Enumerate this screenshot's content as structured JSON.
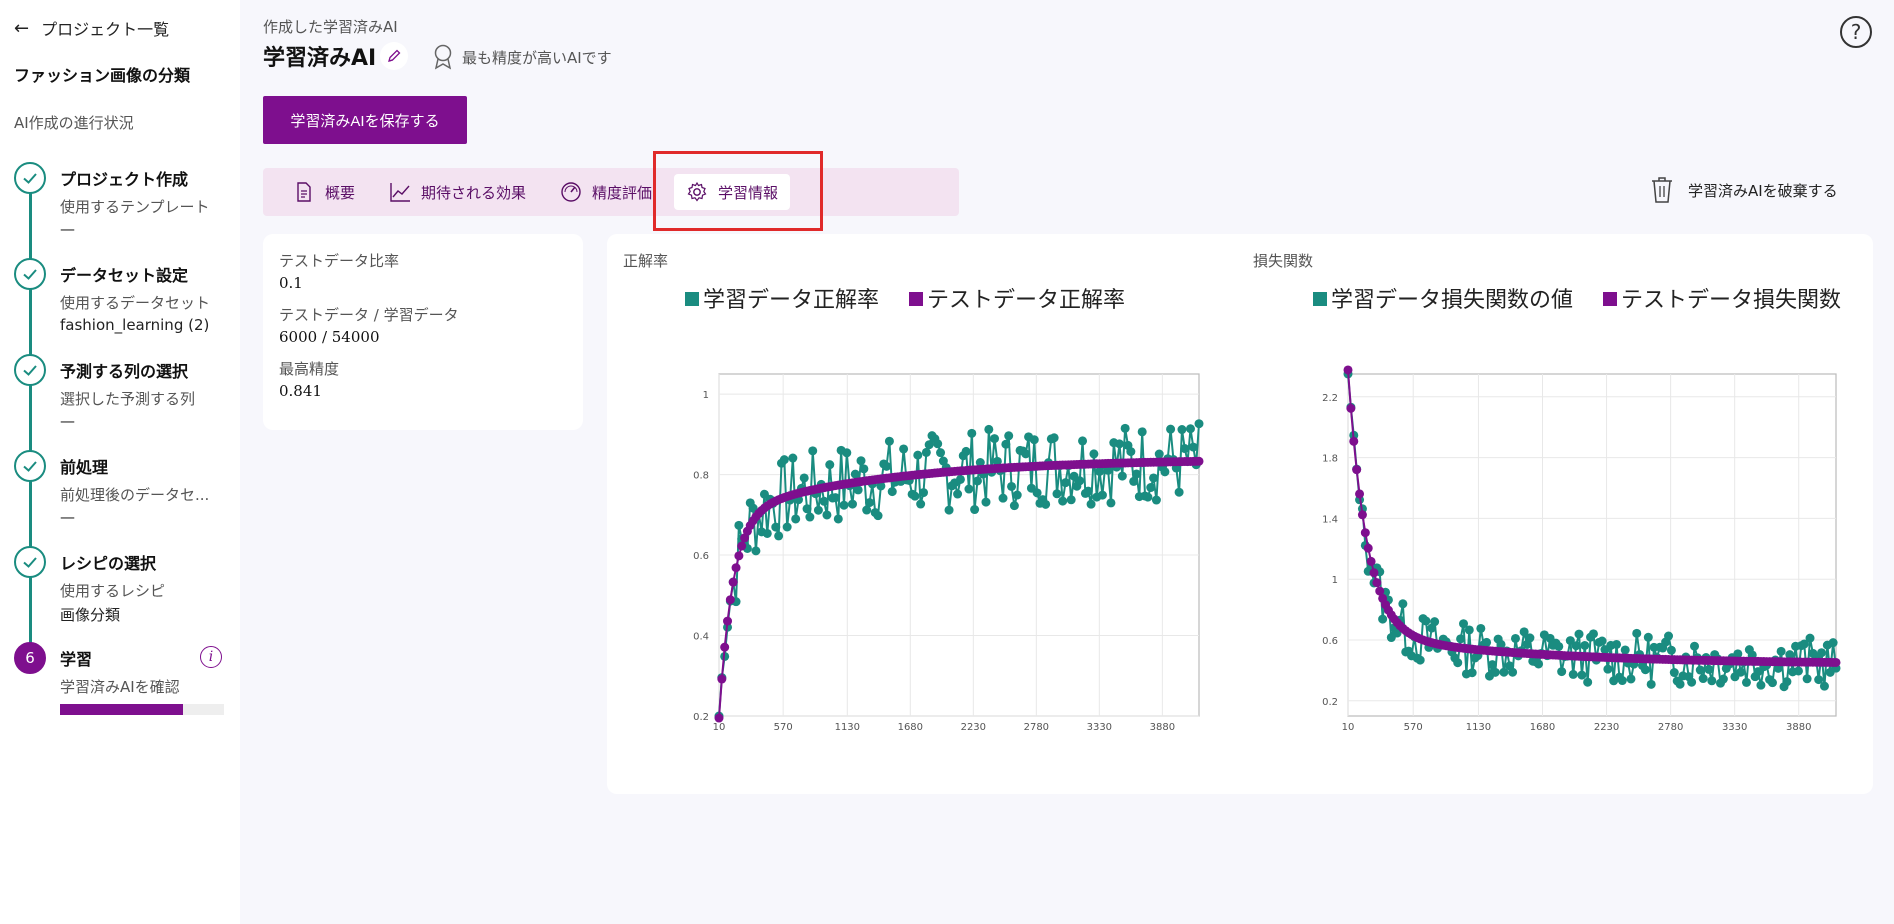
{
  "sidebar": {
    "back_label": "プロジェクト一覧",
    "project_name": "ファッション画像の分類",
    "progress_title": "AI作成の進行状況",
    "steps": [
      {
        "title": "プロジェクト作成",
        "sub": "使用するテンプレート",
        "value": "—"
      },
      {
        "title": "データセット設定",
        "sub": "使用するデータセット",
        "value": "fashion_learning (2)"
      },
      {
        "title": "予測する列の選択",
        "sub": "選択した予測する列",
        "value": "—"
      },
      {
        "title": "前処理",
        "sub": "前処理後のデータセ...",
        "value": "—"
      },
      {
        "title": "レシピの選択",
        "sub": "使用するレシピ",
        "value": "画像分類"
      },
      {
        "number": "6",
        "title": "学習",
        "sub": "学習済みAIを確認",
        "progress": 0.75
      }
    ]
  },
  "header": {
    "breadcrumb": "作成した学習済みAI",
    "title": "学習済みAI",
    "badge": "最も精度が高いAIです",
    "save_label": "学習済みAIを保存する",
    "discard_label": "学習済みAIを破棄する"
  },
  "tabs": [
    {
      "label": "概要"
    },
    {
      "label": "期待される効果"
    },
    {
      "label": "精度評価"
    },
    {
      "label": "学習情報"
    }
  ],
  "stats": [
    {
      "label": "テストデータ比率",
      "value": "0.1"
    },
    {
      "label": "テストデータ / 学習データ",
      "value": "6000 / 54000"
    },
    {
      "label": "最高精度",
      "value": "0.841"
    }
  ],
  "colors": {
    "accent": "#7e0f8e",
    "teal": "#1a8c80"
  },
  "chart_data": [
    {
      "type": "line",
      "label": "正解率",
      "series": [
        {
          "name": "学習データ正解率",
          "color": "#1a8c80"
        },
        {
          "name": "テストデータ正解率",
          "color": "#7e0f8e"
        }
      ],
      "x_ticks": [
        "10",
        "570",
        "1130",
        "1680",
        "2230",
        "2780",
        "3330",
        "3880"
      ],
      "y_ticks": [
        "0.2",
        "0.4",
        "0.6",
        "0.8",
        "1"
      ],
      "xlim": [
        10,
        4200
      ],
      "ylim": [
        0.2,
        1.05
      ],
      "kind": "accuracy",
      "grid": true,
      "legend": "top"
    },
    {
      "type": "line",
      "label": "損失関数",
      "series": [
        {
          "name": "学習データ損失関数の値",
          "color": "#1a8c80"
        },
        {
          "name": "テストデータ損失関数",
          "color": "#7e0f8e"
        }
      ],
      "x_ticks": [
        "10",
        "570",
        "1130",
        "1680",
        "2230",
        "2780",
        "3330",
        "3880"
      ],
      "y_ticks": [
        "0.2",
        "0.6",
        "1",
        "1.4",
        "1.8",
        "2.2"
      ],
      "xlim": [
        10,
        4200
      ],
      "ylim": [
        0.1,
        2.35
      ],
      "kind": "loss",
      "grid": true,
      "legend": "top"
    }
  ]
}
